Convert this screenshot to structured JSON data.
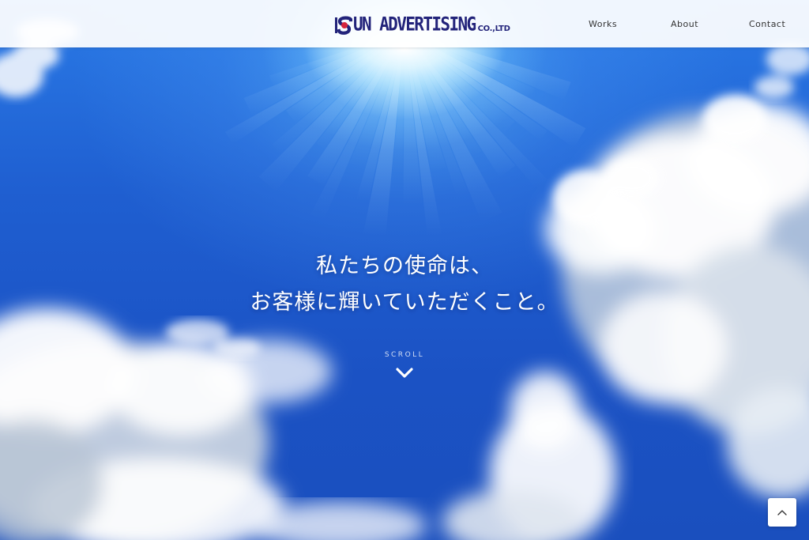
{
  "header": {
    "logo": {
      "text": "UN ADVERTISING",
      "suffix": "CO.,LTD",
      "mark_icon": "sun-logo-mark",
      "color": "#22237a",
      "accent_color": "#d7263d"
    },
    "nav": [
      {
        "label": "Works"
      },
      {
        "label": "About"
      },
      {
        "label": "Contact"
      }
    ]
  },
  "hero": {
    "tagline_line1": "私たちの使命は、",
    "tagline_line2": "お客様に輝いていただくこと。",
    "scroll_label": "SCROLL",
    "scroll_icon": "chevron-down-icon",
    "sky_color": "#1f5fd1"
  },
  "back_to_top": {
    "icon": "chevron-up-icon"
  }
}
